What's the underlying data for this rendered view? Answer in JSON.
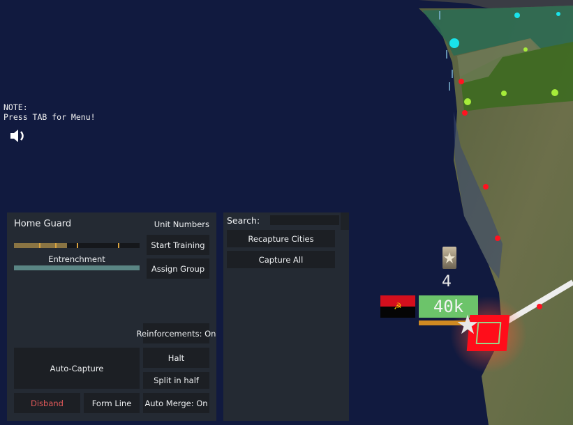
{
  "hud": {
    "note_line1": "NOTE:",
    "note_line2": "Press TAB for Menu!",
    "sound_icon": "speaker-icon"
  },
  "unit_panel": {
    "unit_name": "Home Guard",
    "unit_numbers_label": "Unit Numbers",
    "training_progress": 0.42,
    "training_tick_fractions": [
      0.2,
      0.33,
      0.5,
      0.83
    ],
    "entrenchment_label": "Entrenchment",
    "entrenchment_progress": 1.0,
    "buttons": {
      "start_training": "Start Training",
      "assign_group": "Assign Group",
      "reinforcements": "Reinforcements: On",
      "halt": "Halt",
      "auto_capture": "Auto-Capture",
      "split_in_half": "Split in half",
      "disband": "Disband",
      "form_line": "Form Line",
      "auto_merge": "Auto Merge: On"
    },
    "colors": {
      "training_fill": "#8a7443",
      "training_tick": "#d9a33f",
      "entrenchment_fill": "#5a8584",
      "disband_text": "#e35a5a"
    }
  },
  "action_panel": {
    "search_label": "Search:",
    "search_value": "",
    "buttons": {
      "recapture_cities": "Recapture Cities",
      "capture_all": "Capture All"
    }
  },
  "map_unit": {
    "rank_icon": "rank-star-insignia-icon",
    "count": "4",
    "flag": "angola-flag-icon",
    "strength": "40k",
    "strength_color": "#6cc46a",
    "supply_bar_color": "#d08a22",
    "selected_unit_color": "#ff0d1a"
  },
  "map": {
    "ocean_color": "#111a3f",
    "land_color": "#5f6a45",
    "cities": {
      "cyan": "#19e3ea",
      "lime": "#a6ec3a",
      "red": "#ff1320"
    }
  }
}
